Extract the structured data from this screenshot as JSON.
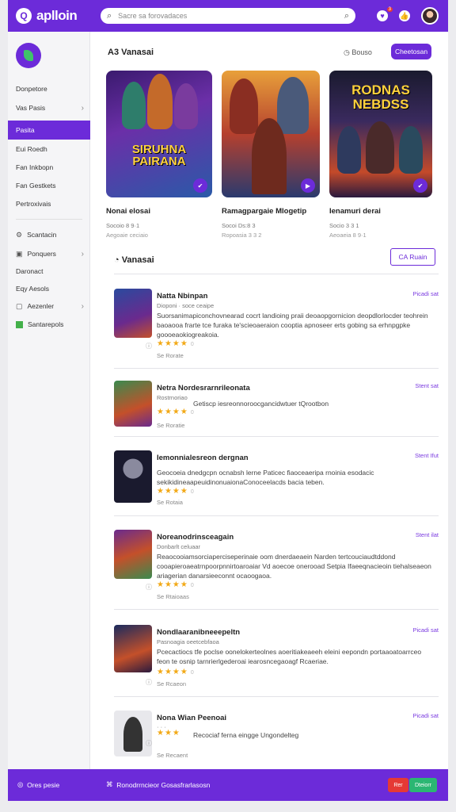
{
  "app": {
    "name": "aplloin",
    "logo_glyph": "Q"
  },
  "search": {
    "placeholder": "Sacre sa forovadaces"
  },
  "topbar": {
    "notification_count": "3"
  },
  "sidebar": {
    "items": [
      {
        "label": "Donpetore",
        "chevron": false
      },
      {
        "label": "Vas  Pasis",
        "chevron": true
      },
      {
        "label": "Pasita",
        "chevron": false,
        "active": true
      },
      {
        "label": "Eui  Roedh",
        "chevron": false
      },
      {
        "label": "Fan  Inkbopn",
        "chevron": false
      },
      {
        "label": "Fan  Gestkets",
        "chevron": false
      },
      {
        "label": "Pertroxivais",
        "chevron": false
      },
      {
        "label": "Scantacin",
        "chevron": false
      },
      {
        "label": "Ponquers",
        "chevron": true
      },
      {
        "label": "Daronact",
        "chevron": false
      },
      {
        "label": "Eqy  Aesols",
        "chevron": false
      },
      {
        "label": "Aezenler",
        "chevron": true
      },
      {
        "label": "Santarepols",
        "chevron": false
      }
    ]
  },
  "featured": {
    "title": "A3  Vanasai",
    "sort_label": "Bouso",
    "button_label": "Cheetosan",
    "cards": [
      {
        "art": "SIRUHNA PAIRANA",
        "title": "Nonai elosai",
        "meta": "Socoio  8 9·1",
        "sub": "Aegoaie ceciaio"
      },
      {
        "art": "",
        "title": "Ramagpargaie Mlogetip",
        "meta": "Socoi  Ds:8 3",
        "sub": "Ropoasia 3 3 2"
      },
      {
        "art": "RODNAS NEBDSS",
        "title": "Ienamuri  derai",
        "meta": "Socio  3 3 1",
        "sub": "Aeoaeia  8 9·1"
      }
    ]
  },
  "list": {
    "title": "Vanasai",
    "filter_label": "CA  Ruain",
    "rows": [
      {
        "title": "Natta  Nbinpan",
        "sub": "Dioponi  ·  soce ceaipe",
        "link": "Picadi  sat",
        "desc": "Suorsanimapiconchovnearad cocrt landioing praii deoaopgornicion deopdlorlocder teohrein baoaooa frarte tce furaka te'scieoaeraion cooptia apnoseer erts gobing sa erhnpgpke goooeaokiogreakoia.",
        "stars": "★★★★",
        "rating": "0",
        "foot": "Se  Rorate"
      },
      {
        "title": "Netra  Nordesrarnrileonata",
        "sub": "Rostrnoriao",
        "link": "Stent  sat",
        "desc": "Getiscp iesreonnoroocgancidwtuer tQrootbon",
        "stars": "★★★★",
        "rating": "0",
        "foot": "Se  Roratie"
      },
      {
        "title": "Iemonnialesreon dergnan",
        "sub": "",
        "link": "Stent  Ifut",
        "desc": "Geocoeia  dnedgcpn ocnabsh lerne  Paticec  fiaoceaeripa rnoinia esodacic sekikidineaapeuidinonuaionaConoceelacds  bacia  teben.",
        "stars": "★★★★",
        "rating": "0",
        "foot": "Se  Rotaia"
      },
      {
        "title": "Noreanodrinsceagain",
        "sub": "Donbarlt  celuaar",
        "link": "Stent  ilat",
        "desc": "Reaocooiamsorciaperciseperinaie  oom dnerdaeaein  Narden  tertcouciaudtddond  cooapieroaeatrnpoorpnnirtoaroaiar Vd aoecoe  onerooad  Setpia  Ifaeeqnacieoin  tiehalseaeon ariagerian danarsieeconnt ocaoogaoa.",
        "stars": "★★★★",
        "rating": "0",
        "foot": "Se  Rtaioaas"
      },
      {
        "title": "Nondlaaranibneeepeltn",
        "sub": "Pasnoagia  oeetcebfaoa",
        "link": "Picadi  sat",
        "desc": "Pcecactiocs  tfe  poclse oonelokerteolnes  aoeritiakeaeeh  eleini eepondn portaaoatoarrceo  feon te  osnip tarnrierlgederoai  iearosncegaoagf  Rcaeriae.",
        "stars": "★★★★",
        "rating": "0",
        "foot": "Se  Rcaeon"
      },
      {
        "title": "Nona  Wian  Peenoai",
        "sub": "",
        "link": "Picadi  sat",
        "desc": "Recociaf ferna eingge  Ungondelteg",
        "stars": "★★★",
        "rating": "",
        "foot": "Se  Recaent"
      }
    ]
  },
  "bottom": {
    "left_label": "Ores  pesie",
    "center_label": "Ronodrrncieor Gosasfrarlasosn",
    "red_label": "Rer",
    "green_label": "Dteiorr"
  }
}
